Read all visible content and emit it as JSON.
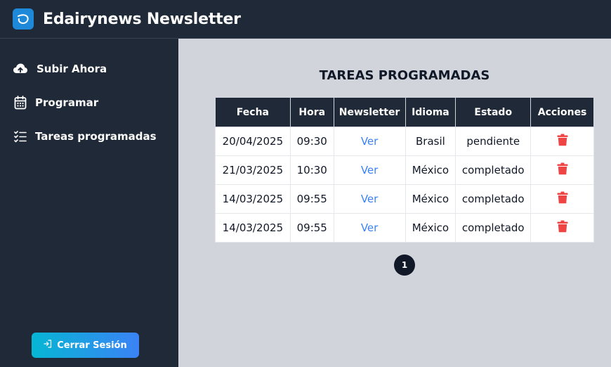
{
  "app": {
    "title": "Edairynews Newsletter"
  },
  "sidebar": {
    "items": [
      {
        "label": "Subir Ahora",
        "icon": "cloud-upload-icon"
      },
      {
        "label": "Programar",
        "icon": "calendar-icon"
      },
      {
        "label": "Tareas programadas",
        "icon": "task-list-icon"
      }
    ],
    "logout_label": "Cerrar Sesión"
  },
  "main": {
    "title": "TAREAS PROGRAMADAS",
    "table": {
      "headers": [
        "Fecha",
        "Hora",
        "Newsletter",
        "Idioma",
        "Estado",
        "Acciones"
      ],
      "rows": [
        {
          "fecha": "20/04/2025",
          "hora": "09:30",
          "newsletter": "Ver",
          "idioma": "Brasil",
          "estado": "pendiente"
        },
        {
          "fecha": "21/03/2025",
          "hora": "10:30",
          "newsletter": "Ver",
          "idioma": "México",
          "estado": "completado"
        },
        {
          "fecha": "14/03/2025",
          "hora": "09:55",
          "newsletter": "Ver",
          "idioma": "México",
          "estado": "completado"
        },
        {
          "fecha": "14/03/2025",
          "hora": "09:55",
          "newsletter": "Ver",
          "idioma": "México",
          "estado": "completado"
        }
      ]
    },
    "pagination": {
      "current_page": "1"
    }
  },
  "colors": {
    "sidebar_bg": "#1f2937",
    "content_bg": "#d1d5db",
    "link": "#3b82f6",
    "delete": "#ef4444",
    "logout_gradient_start": "#06b6d4",
    "logout_gradient_end": "#3b82f6"
  }
}
